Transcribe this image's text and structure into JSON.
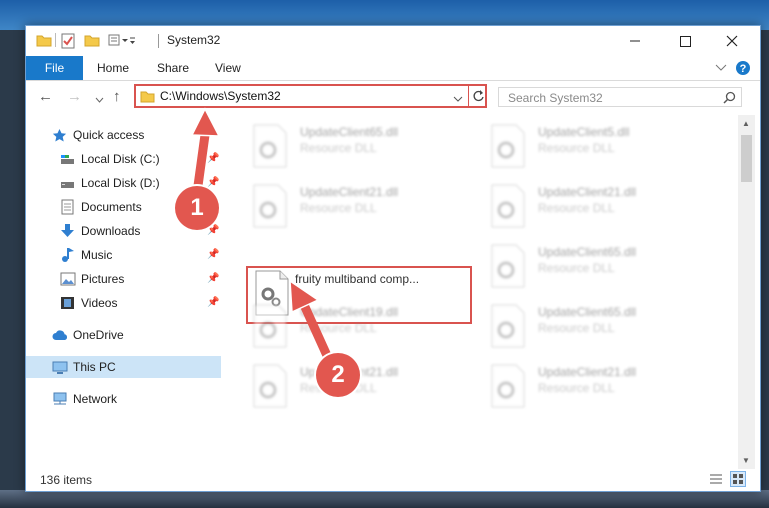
{
  "window": {
    "title": "System32",
    "controls": [
      "minimize-icon",
      "maximize-icon",
      "close-icon"
    ]
  },
  "ribbon": {
    "tabs": [
      {
        "label": "File",
        "active": true
      },
      {
        "label": "Home"
      },
      {
        "label": "Share"
      },
      {
        "label": "View"
      }
    ]
  },
  "address": {
    "path": "C:\\Windows\\System32",
    "search_placeholder": "Search System32"
  },
  "sidebar": {
    "items": [
      {
        "label": "Quick access",
        "icon": "star-icon",
        "pinned": false
      },
      {
        "label": "Local Disk (C:)",
        "icon": "drive-icon",
        "pinned": true
      },
      {
        "label": "Local Disk (D:)",
        "icon": "drive-icon",
        "pinned": true
      },
      {
        "label": "Documents",
        "icon": "documents-icon",
        "pinned": true
      },
      {
        "label": "Downloads",
        "icon": "download-icon",
        "pinned": true
      },
      {
        "label": "Music",
        "icon": "music-icon",
        "pinned": true
      },
      {
        "label": "Pictures",
        "icon": "pictures-icon",
        "pinned": true
      },
      {
        "label": "Videos",
        "icon": "videos-icon",
        "pinned": true
      },
      {
        "label": "OneDrive",
        "icon": "cloud-icon",
        "pinned": false
      },
      {
        "label": "This PC",
        "icon": "computer-icon",
        "pinned": false,
        "selected": true
      },
      {
        "label": "Network",
        "icon": "network-icon",
        "pinned": false
      }
    ]
  },
  "files": [
    {
      "name": "UpdateClient65.dll",
      "desc": "Resource DLL"
    },
    {
      "name": "UpdateClient5.dll",
      "desc": "Resource DLL"
    },
    {
      "name": "UpdateClient21.dll",
      "desc": "Resource DLL"
    },
    {
      "name": "UpdateClient21.dll",
      "desc": "Resource DLL"
    },
    {
      "name": "fruity multiband comp...",
      "desc": "",
      "highlighted": true
    },
    {
      "name": "UpdateClient65.dll",
      "desc": "Resource DLL"
    },
    {
      "name": "UpdateClient19.dll",
      "desc": "Resource DLL"
    },
    {
      "name": "UpdateClient65.dll",
      "desc": "Resource DLL"
    },
    {
      "name": "UpdateClient21.dll",
      "desc": "Resource DLL"
    },
    {
      "name": "UpdateClient21.dll",
      "desc": "Resource DLL"
    }
  ],
  "status": {
    "item_count": "136 items"
  },
  "annotations": [
    {
      "number": "1",
      "target": "address-bar"
    },
    {
      "number": "2",
      "target": "highlighted-file"
    }
  ],
  "colors": {
    "accent": "#1979ca",
    "highlight": "#d9534f",
    "selection": "#cce4f7"
  }
}
